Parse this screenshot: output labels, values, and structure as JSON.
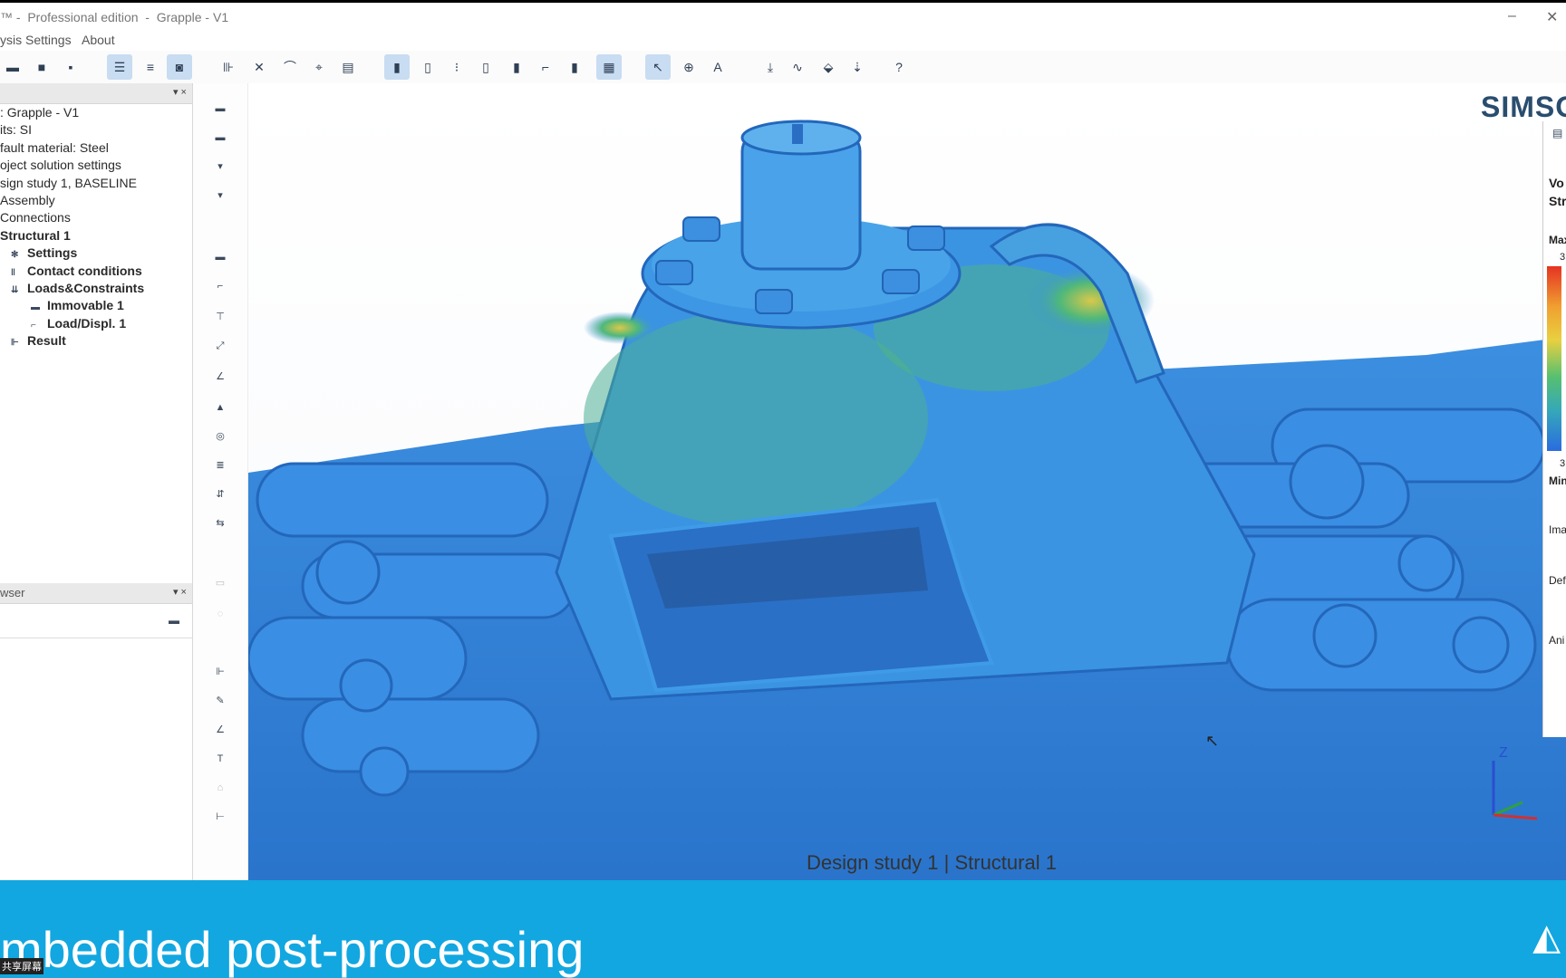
{
  "titlebar": {
    "title": "™ -  Professional edition  -  Grapple - V1",
    "minimize": "–",
    "close": "✕"
  },
  "menu": {
    "items": [
      "ysis",
      "Settings",
      "About"
    ]
  },
  "toolbar": {
    "groups": [
      [
        "folder-open-icon",
        "folder-icon",
        "save-icon"
      ],
      [
        "tree-view-icon",
        "list-view-icon",
        "grid-view-icon"
      ],
      [
        "import-icon",
        "close-geometry-icon",
        "measure-icon",
        "align-icon",
        "report-icon"
      ],
      [
        "boundary-icon",
        "constraint-icon",
        "joint-icon",
        "hinge-icon",
        "contact-icon",
        "rod-icon",
        "spring-icon",
        "solid-icon"
      ],
      [
        "cursor-select-icon",
        "node-icon",
        "text-icon"
      ],
      [
        "load-icon",
        "wave-icon",
        "force-icon",
        "displacement-icon"
      ],
      [
        "help-icon"
      ]
    ],
    "help_label": "?"
  },
  "left_panel": {
    "model_tree": {
      "items": [
        {
          "label": ": Grapple - V1",
          "bold": false,
          "indent": 0,
          "icon": ""
        },
        {
          "label": "its: SI",
          "bold": false,
          "indent": 0,
          "icon": ""
        },
        {
          "label": "fault material: Steel",
          "bold": false,
          "indent": 0,
          "icon": ""
        },
        {
          "label": "oject solution settings",
          "bold": false,
          "indent": 0,
          "icon": ""
        },
        {
          "label": "sign study 1, BASELINE",
          "bold": false,
          "indent": 0,
          "icon": ""
        },
        {
          "label": "Assembly",
          "bold": false,
          "indent": 0,
          "icon": ""
        },
        {
          "label": "Connections",
          "bold": false,
          "indent": 0,
          "icon": ""
        },
        {
          "label": "Structural  1",
          "bold": true,
          "indent": 0,
          "icon": ""
        },
        {
          "label": "Settings",
          "bold": true,
          "indent": 1,
          "icon": "gear"
        },
        {
          "label": "Contact conditions",
          "bold": true,
          "indent": 1,
          "icon": "contact"
        },
        {
          "label": "Loads&Constraints",
          "bold": true,
          "indent": 1,
          "icon": "loads"
        },
        {
          "label": "Immovable 1",
          "bold": true,
          "indent": 2,
          "icon": "immovable"
        },
        {
          "label": "Load/Displ. 1",
          "bold": true,
          "indent": 2,
          "icon": "load"
        },
        {
          "label": "Result",
          "bold": true,
          "indent": 1,
          "icon": "result"
        }
      ]
    },
    "browser_header": "wser"
  },
  "viewport": {
    "logo": "SIMSO",
    "caption": "Design study 1 | Structural  1"
  },
  "right_panel": {
    "lines": [
      "Vo",
      "Stre",
      "Max",
      "3",
      "3",
      "Min",
      "Ima",
      "Def",
      "Ani"
    ]
  },
  "banner": {
    "text": "mbedded post-processing",
    "tag": "共享屏幕"
  },
  "colors": {
    "banner": "#12a7e0",
    "mesh_base": "#2f7fd8",
    "mesh_high": "#e8c23a",
    "accent_toolbar": "#c8dcf2"
  }
}
